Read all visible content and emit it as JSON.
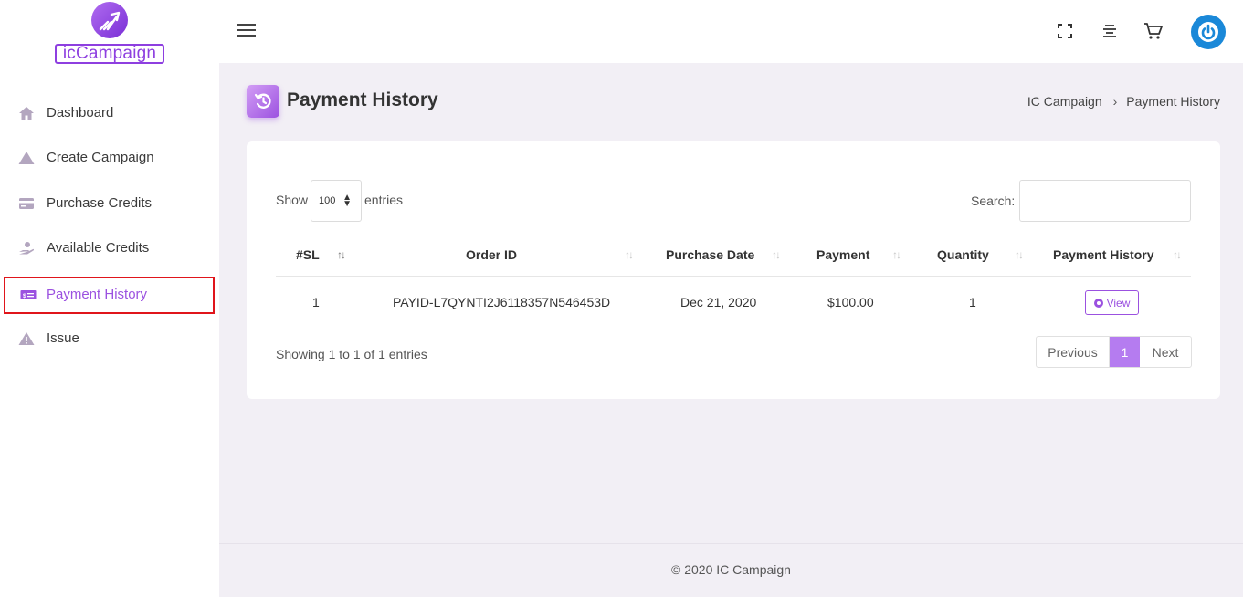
{
  "brand": {
    "name": "icCampaign",
    "accent": "#9b51e0"
  },
  "sidebar": {
    "items": [
      {
        "label": "Dashboard",
        "icon": "home-icon"
      },
      {
        "label": "Create Campaign",
        "icon": "triangle-icon"
      },
      {
        "label": "Purchase Credits",
        "icon": "credit-card-icon"
      },
      {
        "label": "Available Credits",
        "icon": "hand-coin-icon"
      },
      {
        "label": "Payment History",
        "icon": "money-bill-icon",
        "active": true
      },
      {
        "label": "Issue",
        "icon": "warning-icon"
      }
    ]
  },
  "topbar": {
    "icons": [
      "menu-icon",
      "fullscreen-icon",
      "align-center-icon",
      "cart-icon",
      "power-icon"
    ]
  },
  "page": {
    "title": "Payment History",
    "breadcrumb": [
      "IC Campaign",
      "Payment History"
    ]
  },
  "table": {
    "show_label": "Show",
    "page_size": "100",
    "entries_label": "entries",
    "search_label": "Search:",
    "search_value": "",
    "columns": [
      "#SL",
      "Order ID",
      "Purchase Date",
      "Payment",
      "Quantity",
      "Payment History"
    ],
    "rows": [
      {
        "sl": "1",
        "order_id": "PAYID-L7QYNTI2J6118357N546453D",
        "date": "Dec 21, 2020",
        "payment": "$100.00",
        "quantity": "1",
        "action": "View"
      }
    ],
    "info": "Showing 1 to 1 of 1 entries",
    "pagination": {
      "previous": "Previous",
      "current": "1",
      "next": "Next"
    }
  },
  "footer": {
    "text": "© 2020 IC Campaign"
  }
}
